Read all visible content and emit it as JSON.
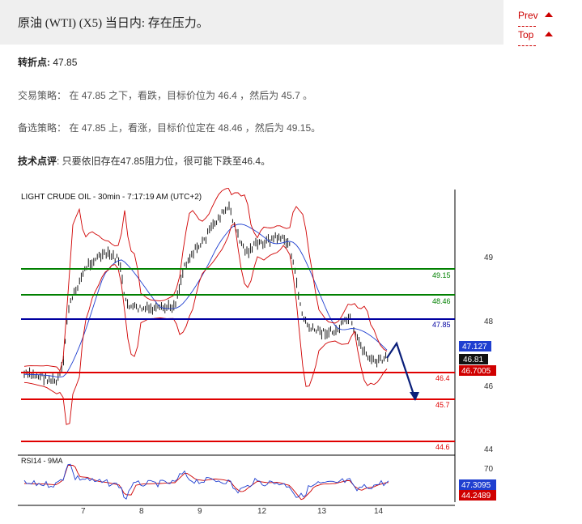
{
  "header": {
    "title": "原油 (WTI) (X5) 当日内: 存在压力。",
    "nav_prev": "Prev",
    "nav_top": "Top"
  },
  "text": {
    "pivot_label": "转折点:",
    "pivot_value": "47.85",
    "strategy_label": "交易策略：",
    "strategy_text": "在 47.85 之下，看跌，目标价位为 46.4 ，然后为 45.7 。",
    "alt_label": "备选策略：",
    "alt_text": "在 47.85 上，看涨，目标价位定在 48.46 ，然后为 49.15。",
    "comment_label": "技术点评",
    "comment_text": ": 只要依旧存在47.85阻力位，很可能下跌至46.4。"
  },
  "chart": {
    "title": "LIGHT CRUDE OIL - 30min - 7:17:19 AM (UTC+2)",
    "rsi_label": "RSI14 - 9MA",
    "price_axis": [
      "49",
      "48",
      "46",
      "44"
    ],
    "rsi_axis": [
      "70"
    ],
    "x_ticks": [
      "7",
      "8",
      "9",
      "12",
      "13",
      "14"
    ],
    "levels": [
      {
        "label": "49.15",
        "value": 49.15,
        "color": "#008000"
      },
      {
        "label": "48.46",
        "value": 48.46,
        "color": "#008000"
      },
      {
        "label": "47.85",
        "value": 47.85,
        "color": "#0000a0"
      },
      {
        "label": "46.4",
        "value": 46.4,
        "color": "#e00000"
      },
      {
        "label": "45.7",
        "value": 45.7,
        "color": "#e00000"
      },
      {
        "label": "44.6",
        "value": 44.6,
        "color": "#e00000"
      }
    ],
    "badges": {
      "ma_blue": "47.127",
      "price_black": "46.81",
      "band_red": "46.7005",
      "rsi_blue": "47.3095",
      "rsi_red": "44.2489"
    },
    "colors": {
      "green": "#008000",
      "blue": "#0000a0",
      "red": "#e00000",
      "arrow": "#0a1f7a"
    }
  }
}
